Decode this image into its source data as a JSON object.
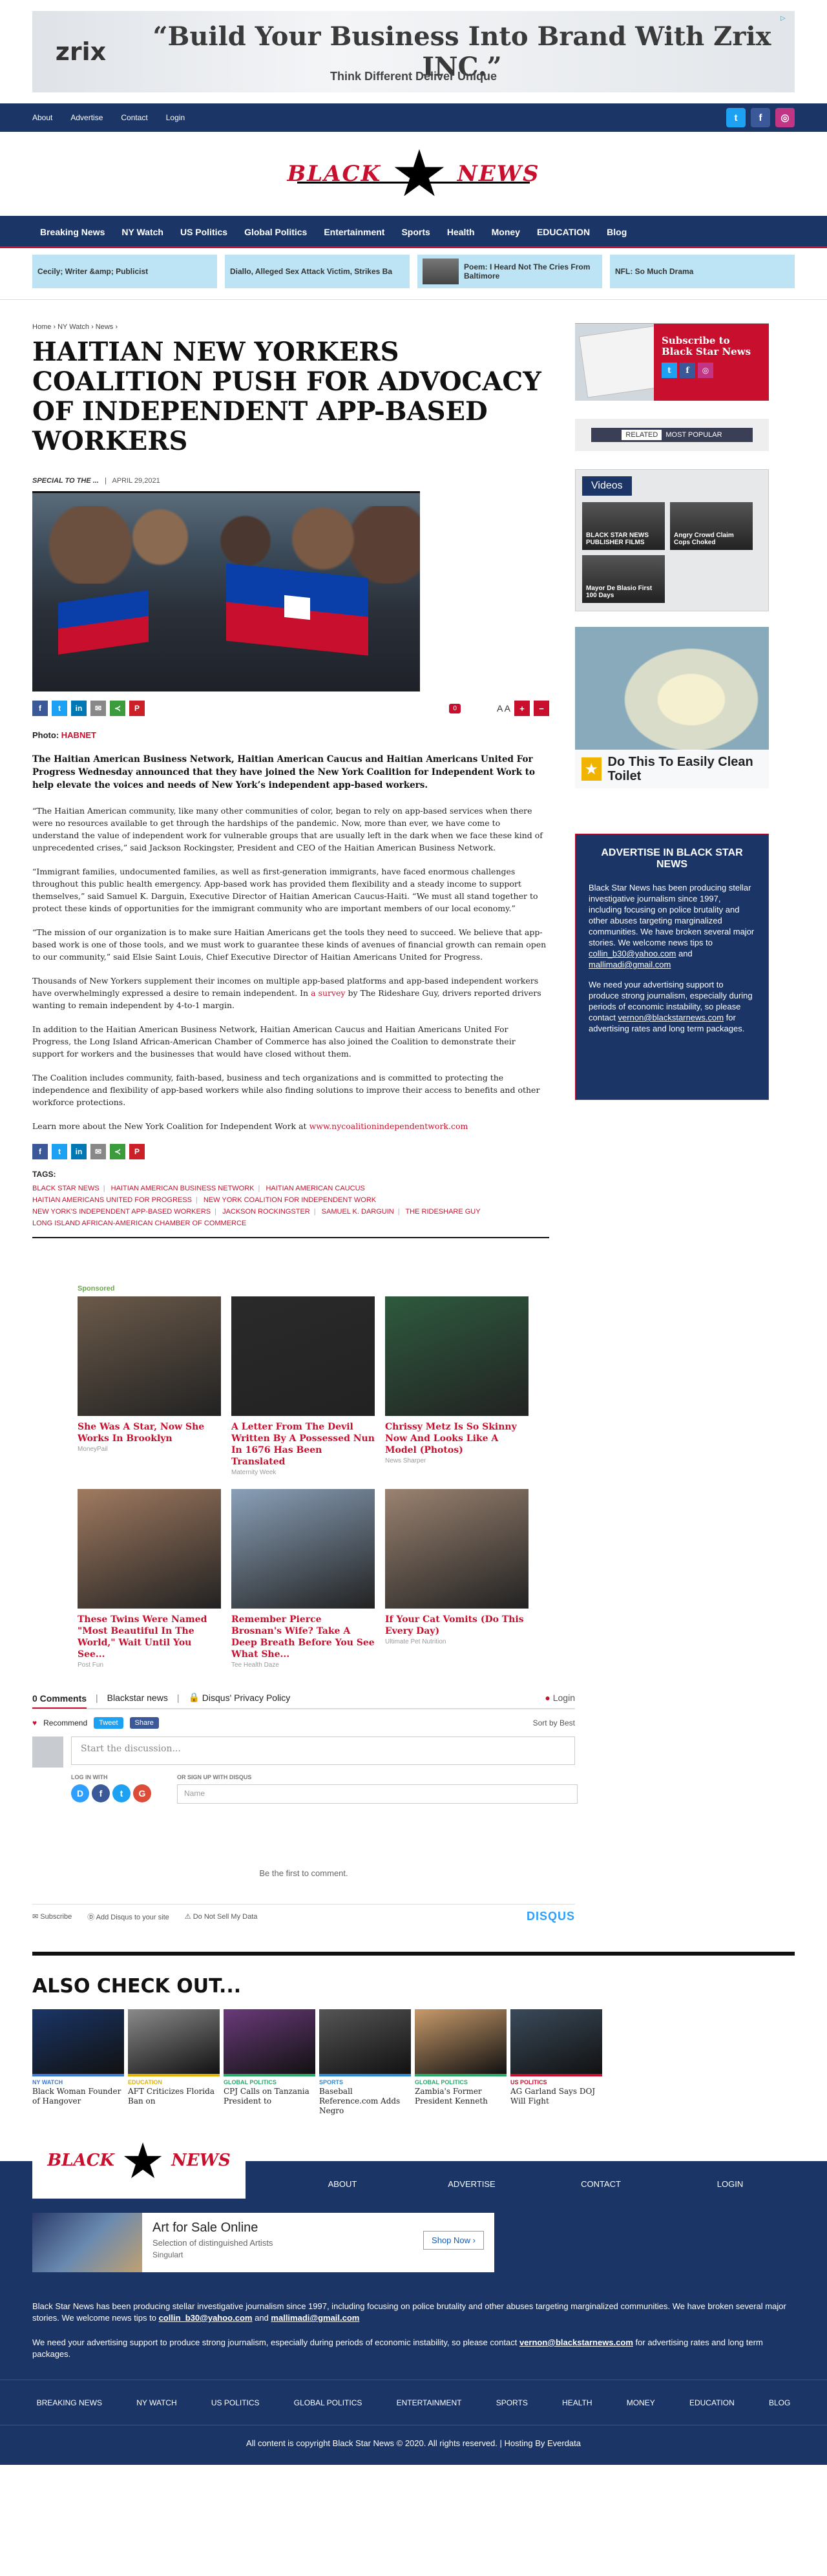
{
  "top_ad": {
    "brand": "zrix",
    "headline": "“Build Your Business Into Brand With Zrix INC.”",
    "subline": "Think Different Deliver Unique"
  },
  "topnav": [
    "About",
    "Advertise",
    "Contact",
    "Login"
  ],
  "logo": {
    "left": "BLACK",
    "right": "NEWS"
  },
  "mainnav": [
    "Breaking News",
    "NY Watch",
    "US Politics",
    "Global Politics",
    "Entertainment",
    "Sports",
    "Health",
    "Money",
    "EDUCATION",
    "Blog"
  ],
  "ticker": [
    "Cecily; Writer &amp; Publicist",
    "Diallo, Alleged Sex Attack Victim, Strikes Ba",
    "Poem: I Heard Not The Cries From Baltimore",
    "NFL: So Much Drama"
  ],
  "article": {
    "breadcrumb": "Home › NY Watch › News ›",
    "title": "HAITIAN NEW YORKERS COALITION PUSH FOR ADVOCACY OF INDEPENDENT APP-BASED WORKERS",
    "author": "SPECIAL TO THE ...",
    "date": "APRIL 29,2021",
    "comment_count": "0",
    "aa": "A A",
    "photo_label": "Photo:",
    "photo_credit": "HABNET",
    "lead": "The Haitian American Business Network, Haitian American Caucus and Haitian Americans United For Progress Wednesday announced that they have joined the New York Coalition for Independent Work to help elevate the voices and needs of New York’s independent app-based workers.",
    "paragraphs": [
      "“The Haitian American community, like many other communities of color, began to rely on app-based services when there were no resources available to get through the hardships of the pandemic. Now, more than ever, we have come to understand the value of independent work for vulnerable groups that are usually left in the dark when we face these kind of unprecedented crises,” said Jackson Rockingster, President and CEO of the Haitian American Business Network.",
      "“Immigrant families, undocumented families, as well as first-generation immigrants, have faced enormous challenges throughout this public health emergency. App-based work has provided them flexibility and a steady income to support themselves,” said Samuel K. Darguin, Executive Director of Haitian American Caucus-Haiti. “We must all stand together to protect these kinds of opportunities for the immigrant community who are important members of our local economy.”",
      "“The mission of our organization is to make sure Haitian Americans get the tools they need to succeed. We believe that app-based work is one of those tools, and we must work to guarantee these kinds of avenues of financial growth can remain open to our community,” said Elsie Saint Louis, Chief Executive Director of Haitian Americans United for Progress."
    ],
    "p4_a": "Thousands of New Yorkers supplement their incomes on multiple app-based platforms and app-based independent workers have overwhelmingly expressed a desire to remain independent. In",
    "p4_link": "a survey",
    "p4_b": "by The Rideshare Guy, drivers reported drivers wanting to remain independent by 4-to-1 margin.",
    "paragraphs2": [
      "In addition to the Haitian American Business Network, Haitian American Caucus and Haitian Americans United For Progress, the Long Island African-American Chamber of Commerce has also joined the Coalition to demonstrate their support for workers and the businesses that would have closed without them.",
      "The Coalition includes community, faith-based, business and tech organizations and is committed to protecting the independence and flexibility of app-based workers while also finding solutions to improve their access to benefits and other workforce protections."
    ],
    "learn_more": "Learn more about the New York Coalition for Independent Work at",
    "learn_link": "www.nycoalitionindependentwork.com",
    "tags_label": "TAGS:",
    "tags": [
      "BLACK STAR NEWS",
      "HAITIAN AMERICAN BUSINESS NETWORK",
      "HAITIAN AMERICAN CAUCUS",
      "HAITIAN AMERICANS UNITED FOR PROGRESS",
      "NEW YORK COALITION FOR INDEPENDENT WORK",
      "NEW YORK'S INDEPENDENT APP-BASED WORKERS",
      "JACKSON ROCKINGSTER",
      "SAMUEL K. DARGUIN",
      "THE RIDESHARE GUY",
      "LONG ISLAND AFRICAN-AMERICAN CHAMBER OF COMMERCE"
    ]
  },
  "sponsored": {
    "label": "Sponsored",
    "items": [
      {
        "title": "She Was A Star, Now She Works In Brooklyn",
        "source": "MoneyPail",
        "color": "#6b5a4a"
      },
      {
        "title": "A Letter From The Devil Written By A Possessed Nun In 1676 Has Been Translated",
        "source": "Maternity Week",
        "color": "#2a2a2a"
      },
      {
        "title": "Chrissy Metz Is So Skinny Now And Looks Like A Model (Photos)",
        "source": "News Sharper",
        "color": "#2e5a3e"
      },
      {
        "title": "These Twins Were Named \"Most Beautiful In The World,\" Wait Until You See...",
        "source": "Post Fun",
        "color": "#a07a60"
      },
      {
        "title": "Remember Pierce Brosnan's Wife? Take A Deep Breath Before You See What She...",
        "source": "Tee Health Daze",
        "color": "#8aa0b8"
      },
      {
        "title": "If Your Cat Vomits (Do This Every Day)",
        "source": "Ultimate Pet Nutrition",
        "color": "#9a8270"
      }
    ]
  },
  "disqus": {
    "comments": "0 Comments",
    "site": "Blackstar news",
    "privacy": "Disqus' Privacy Policy",
    "login": "Login",
    "recommend": "Recommend",
    "tweet": "Tweet",
    "share": "Share",
    "sort": "Sort by Best",
    "placeholder": "Start the discussion...",
    "log_in_with": "LOG IN WITH",
    "sign_up": "OR SIGN UP WITH DISQUS",
    "name_placeholder": "Name",
    "first": "Be the first to comment.",
    "subscribe": "Subscribe",
    "add": "Add Disqus to your site",
    "dnsmd": "Do Not Sell My Data",
    "brand": "DISQUS"
  },
  "also": {
    "heading": "ALSO CHECK OUT...",
    "items": [
      {
        "cat": "NY WATCH",
        "title": "Black Woman Founder of Hangover",
        "color": "#1a3566",
        "bar": "#3b7bd6"
      },
      {
        "cat": "EDUCATION",
        "title": "AFT Criticizes Florida Ban on",
        "color": "#8a8a8a",
        "bar": "#e2b200"
      },
      {
        "cat": "GLOBAL POLITICS",
        "title": "CPJ Calls on Tanzania President to",
        "color": "#6a3a7a",
        "bar": "#2aa86a"
      },
      {
        "cat": "SPORTS",
        "title": "Baseball Reference.com Adds Negro",
        "color": "#555555",
        "bar": "#2a8ad6"
      },
      {
        "cat": "GLOBAL POLITICS",
        "title": "Zambia's Former President Kenneth",
        "color": "#c89a6a",
        "bar": "#2aa86a"
      },
      {
        "cat": "US POLITICS",
        "title": "AG Garland Says DOJ Will Fight",
        "color": "#3a4a5a",
        "bar": "#c8102e"
      }
    ]
  },
  "side": {
    "subscribe": "Subscribe to Black Star News",
    "related": "RELATED",
    "popular": "MOST POPULAR",
    "videos": "Videos",
    "video_items": [
      "BLACK STAR NEWS PUBLISHER FILMS",
      "Angry Crowd Claim Cops Choked",
      "Mayor De Blasio First 100 Days"
    ],
    "toilet_ad": "Do This To Easily Clean Toilet",
    "adv_title": "ADVERTISE IN BLACK STAR NEWS",
    "adv_p1": "Black Star News has been producing stellar investigative journalism since 1997, including focusing on police brutality and other abuses targeting marginalized communities. We have broken several major stories. We welcome news tips to",
    "adv_email1": "collin_b30@yahoo.com",
    "adv_and": "and",
    "adv_email2": "mallimadi@gmail.com",
    "adv_p2": "We need your advertising support to produce strong journalism, especially during periods of economic instability, so please contact",
    "adv_email3": "vernon@blackstarnews.com",
    "adv_p2b": "for advertising rates and long term packages."
  },
  "footer": {
    "links": [
      "ABOUT",
      "ADVERTISE",
      "CONTACT",
      "LOGIN"
    ],
    "ad_title": "Art for Sale Online",
    "ad_sub": "Selection of distinguished Artists",
    "ad_brand": "Singulart",
    "ad_btn": "Shop Now",
    "text1": "Black Star News has been producing stellar investigative journalism since 1997, including focusing on police brutality and other abuses targeting marginalized communities. We have broken several major stories. We welcome news tips to",
    "text1_e1": "collin_b30@yahoo.com",
    "text1_and": "and",
    "text1_e2": "mallimadi@gmail.com",
    "text2": "We need your advertising support to produce strong journalism, especially during periods of economic instability, so please contact",
    "text2_e": "vernon@blackstarnews.com",
    "text2_b": "for advertising rates and long term packages.",
    "nav": [
      "BREAKING NEWS",
      "NY WATCH",
      "US POLITICS",
      "GLOBAL POLITICS",
      "ENTERTAINMENT",
      "SPORTS",
      "HEALTH",
      "MONEY",
      "EDUCATION",
      "BLOG"
    ],
    "copyright": "All content is copyright Black Star News © 2020. All rights reserved. | Hosting By Everdata"
  }
}
